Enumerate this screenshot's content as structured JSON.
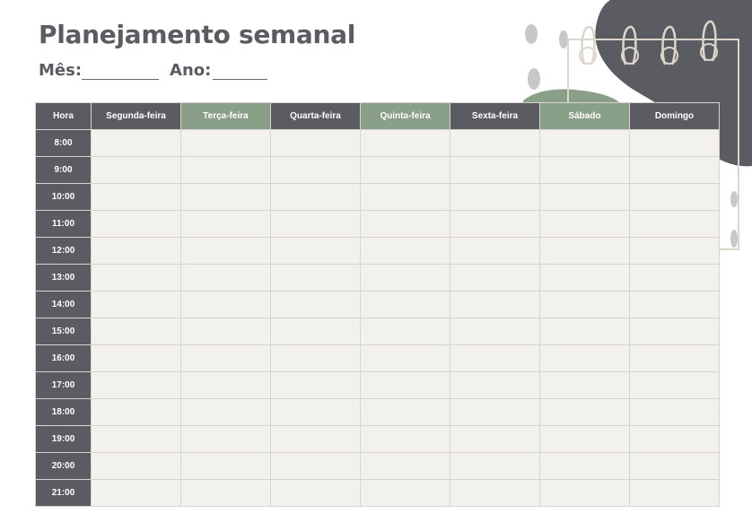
{
  "planner": {
    "title": "Planejamento semanal",
    "month_label": "Mês:",
    "year_label": "Ano:",
    "hour_header": "Hora",
    "days": [
      {
        "label": "Segunda-feira",
        "accent": false
      },
      {
        "label": "Terça-feira",
        "accent": true
      },
      {
        "label": "Quarta-feira",
        "accent": false
      },
      {
        "label": "Quinta-feira",
        "accent": true
      },
      {
        "label": "Sexta-feira",
        "accent": false
      },
      {
        "label": "Sábado",
        "accent": true
      },
      {
        "label": "Domingo",
        "accent": false
      }
    ],
    "hours": [
      "8:00",
      "9:00",
      "10:00",
      "11:00",
      "12:00",
      "13:00",
      "14:00",
      "15:00",
      "16:00",
      "17:00",
      "18:00",
      "19:00",
      "20:00",
      "21:00"
    ]
  },
  "colors": {
    "dark": "#5b5c61",
    "accent": "#8a9f88",
    "cell": "#f3f1ee",
    "border": "#d9d3cf",
    "blob_gray": "#c6c8c9"
  },
  "decor": {
    "icon": "spiral-notepad-icon"
  }
}
